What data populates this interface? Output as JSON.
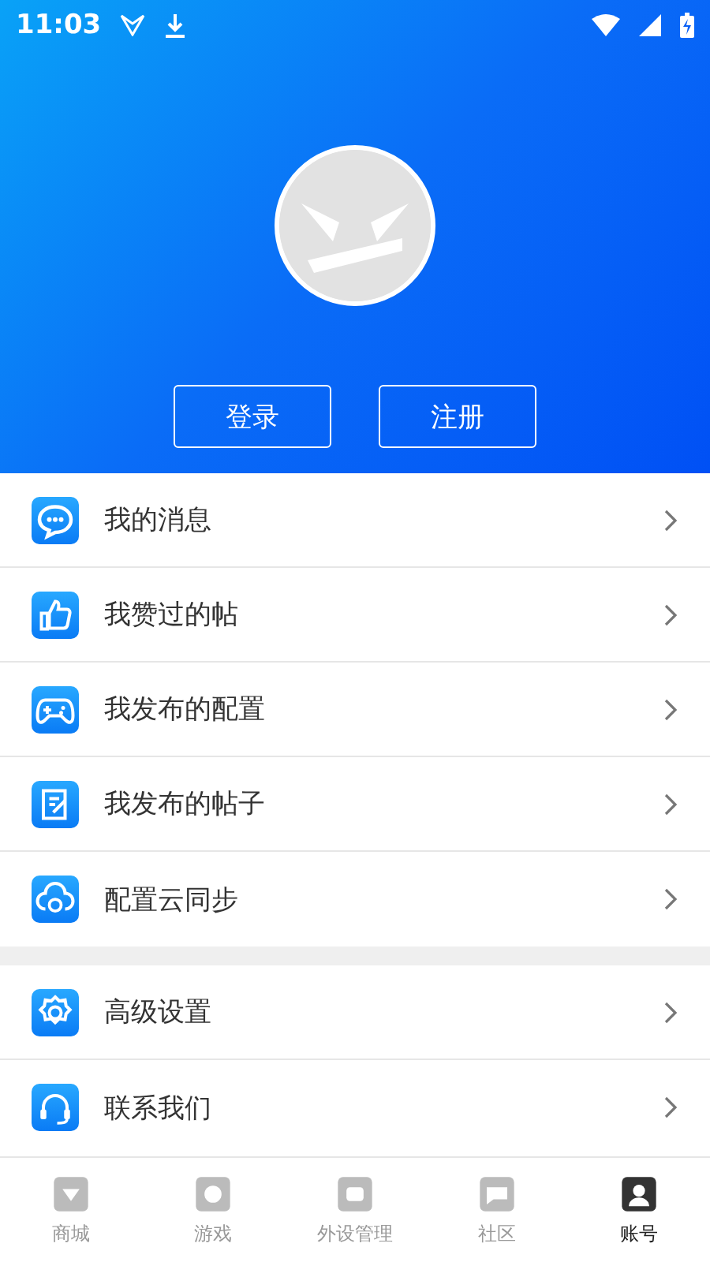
{
  "status_bar": {
    "time": "11:03"
  },
  "header": {
    "buttons": [
      "登录",
      "注册"
    ]
  },
  "menu_groups": [
    [
      {
        "label": "我的消息"
      },
      {
        "label": "我赞过的帖"
      },
      {
        "label": "我发布的配置"
      },
      {
        "label": "我发布的帖子"
      },
      {
        "label": "配置云同步"
      }
    ],
    [
      {
        "label": "高级设置"
      },
      {
        "label": "联系我们"
      }
    ]
  ],
  "tab_bar": [
    {
      "label": "商城",
      "selected": false
    },
    {
      "label": "游戏",
      "selected": false
    },
    {
      "label": "外设管理",
      "selected": false
    },
    {
      "label": "社区",
      "selected": false
    },
    {
      "label": "账号",
      "selected": true
    }
  ]
}
